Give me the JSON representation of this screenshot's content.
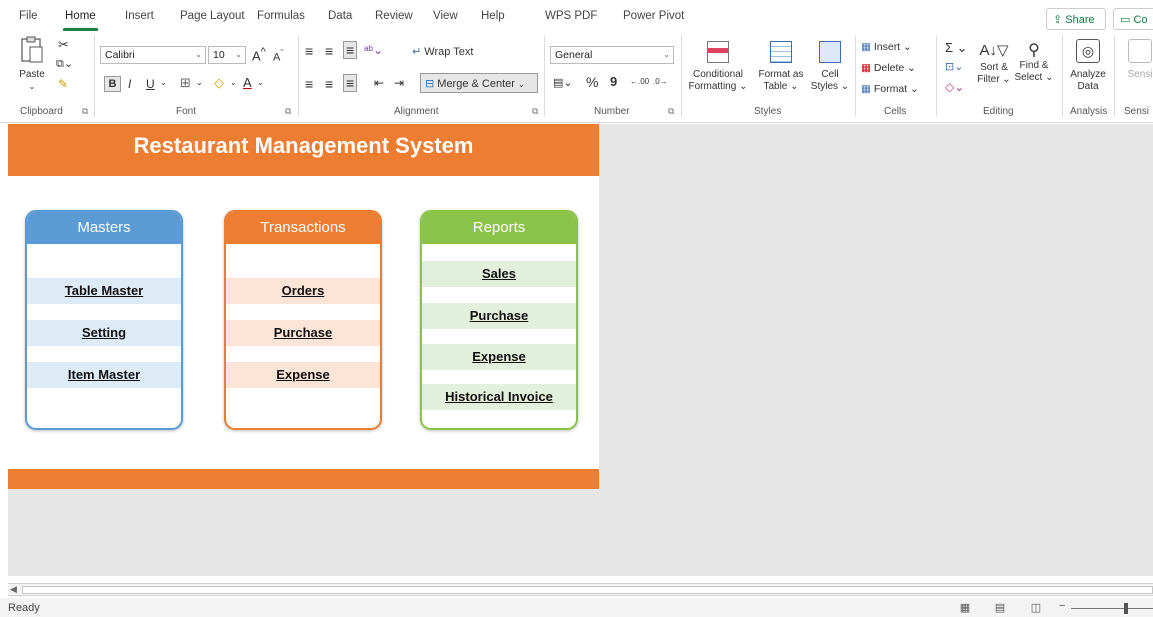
{
  "menu": {
    "tabs": [
      "File",
      "Home",
      "Insert",
      "Page Layout",
      "Formulas",
      "Data",
      "Review",
      "View",
      "Help",
      "WPS PDF",
      "Power Pivot"
    ],
    "active_tab": "Home",
    "share_label": "Share",
    "comments_label": "Co"
  },
  "ribbon": {
    "clipboard": {
      "paste_label": "Paste",
      "group_label": "Clipboard"
    },
    "font": {
      "font_name": "Calibri",
      "font_size": "10",
      "bold": "B",
      "italic": "I",
      "underline": "U",
      "grow_font": "A",
      "shrink_font": "A",
      "font_color_letter": "A",
      "group_label": "Font"
    },
    "alignment": {
      "wrap_text": "Wrap Text",
      "merge_center": "Merge & Center",
      "group_label": "Alignment"
    },
    "number": {
      "format": "General",
      "percent": "%",
      "comma": "9",
      "inc_decimal": ".00",
      "dec_decimal": ".0",
      "group_label": "Number"
    },
    "styles": {
      "conditional_formatting_1": "Conditional",
      "conditional_formatting_2": "Formatting",
      "format_as_table_1": "Format as",
      "format_as_table_2": "Table",
      "cell_styles_1": "Cell",
      "cell_styles_2": "Styles",
      "group_label": "Styles"
    },
    "cells": {
      "insert": "Insert",
      "delete": "Delete",
      "format": "Format",
      "group_label": "Cells"
    },
    "editing": {
      "sort_filter_1": "Sort &",
      "sort_filter_2": "Filter",
      "find_select_1": "Find &",
      "find_select_2": "Select",
      "group_label": "Editing"
    },
    "analysis": {
      "analyze_1": "Analyze",
      "analyze_2": "Data",
      "group_label": "Analysis"
    },
    "sensitivity": {
      "label": "Sensi",
      "group_label": "Sensi"
    }
  },
  "sheet": {
    "title": "Restaurant Management System",
    "cards": [
      {
        "heading": "Masters",
        "color": "#5b9bd5",
        "stripe": "#ddebf7",
        "border": "#5b9bd5",
        "items": [
          "Table Master",
          "Setting",
          "Item Master"
        ]
      },
      {
        "heading": "Transactions",
        "color": "#ed7d31",
        "stripe": "#fce4d6",
        "border": "#ed7d31",
        "items": [
          "Orders",
          "Purchase",
          "Expense"
        ]
      },
      {
        "heading": "Reports",
        "color": "#8bc34a",
        "stripe": "#e2efda",
        "border": "#8bc34a",
        "items": [
          "Sales",
          "Purchase",
          "Expense",
          "Historical Invoice"
        ]
      }
    ],
    "accent_color": "#ed7d31"
  },
  "status": {
    "ready": "Ready"
  },
  "colors": {
    "excel_green": "#107c41",
    "sheet_bg": "#e6e6e6"
  }
}
